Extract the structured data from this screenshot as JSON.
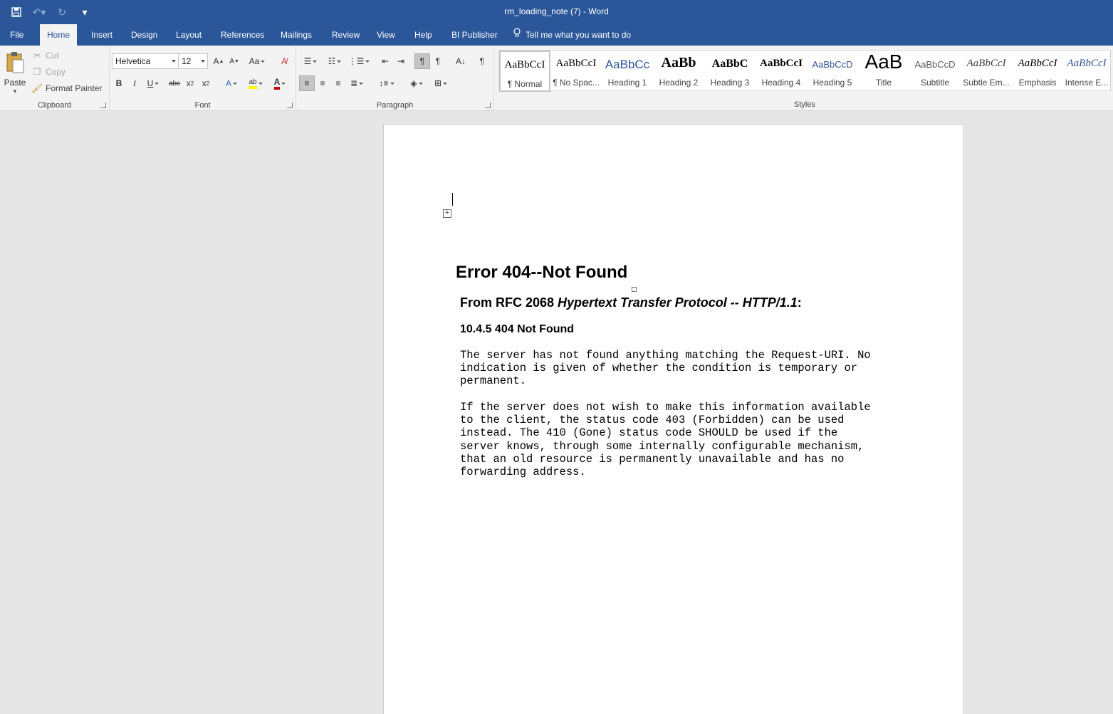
{
  "titlebar": {
    "title": "rm_loading_note (7)  -  Word"
  },
  "tabs": [
    "File",
    "Home",
    "Insert",
    "Design",
    "Layout",
    "References",
    "Mailings",
    "Review",
    "View",
    "Help",
    "BI Publisher"
  ],
  "tell_me": "Tell me what you want to do",
  "clipboard": {
    "paste": "Paste",
    "cut": "Cut",
    "copy": "Copy",
    "format_painter": "Format Painter",
    "label": "Clipboard"
  },
  "font": {
    "name": "Helvetica",
    "size": "12",
    "label": "Font"
  },
  "paragraph": {
    "label": "Paragraph"
  },
  "styles": {
    "label": "Styles",
    "items": [
      {
        "preview": "AaBbCcI",
        "name": "¶ Normal"
      },
      {
        "preview": "AaBbCcI",
        "name": "¶ No Spac..."
      },
      {
        "preview": "AaBbCc",
        "name": "Heading 1"
      },
      {
        "preview": "AaBb",
        "name": "Heading 2"
      },
      {
        "preview": "AaBbC",
        "name": "Heading 3"
      },
      {
        "preview": "AaBbCcI",
        "name": "Heading 4"
      },
      {
        "preview": "AaBbCcD",
        "name": "Heading 5"
      },
      {
        "preview": "AaB",
        "name": "Title"
      },
      {
        "preview": "AaBbCcD",
        "name": "Subtitle"
      },
      {
        "preview": "AaBbCcI",
        "name": "Subtle Em..."
      },
      {
        "preview": "AaBbCcI",
        "name": "Emphasis"
      },
      {
        "preview": "AaBbCcI",
        "name": "Intense E..."
      }
    ]
  },
  "document": {
    "heading": "Error 404--Not Found",
    "rfc_prefix": "From RFC 2068 ",
    "rfc_italic": "Hypertext Transfer Protocol -- HTTP/1.1",
    "rfc_suffix": ":",
    "section": "10.4.5 404 Not Found",
    "para1": "The server has not found anything matching the Request-URI. No\nindication is given of whether the condition is temporary or\npermanent.",
    "para2": "If the server does not wish to make this information available\nto the client, the status code 403 (Forbidden) can be used\ninstead. The 410 (Gone) status code SHOULD be used if the\nserver knows, through some internally configurable mechanism,\nthat an old resource is permanently unavailable and has no\nforwarding address."
  },
  "colors": {
    "brand": "#2b579a",
    "ribbon": "#f3f3f3",
    "canvas": "#e6e6e6"
  }
}
